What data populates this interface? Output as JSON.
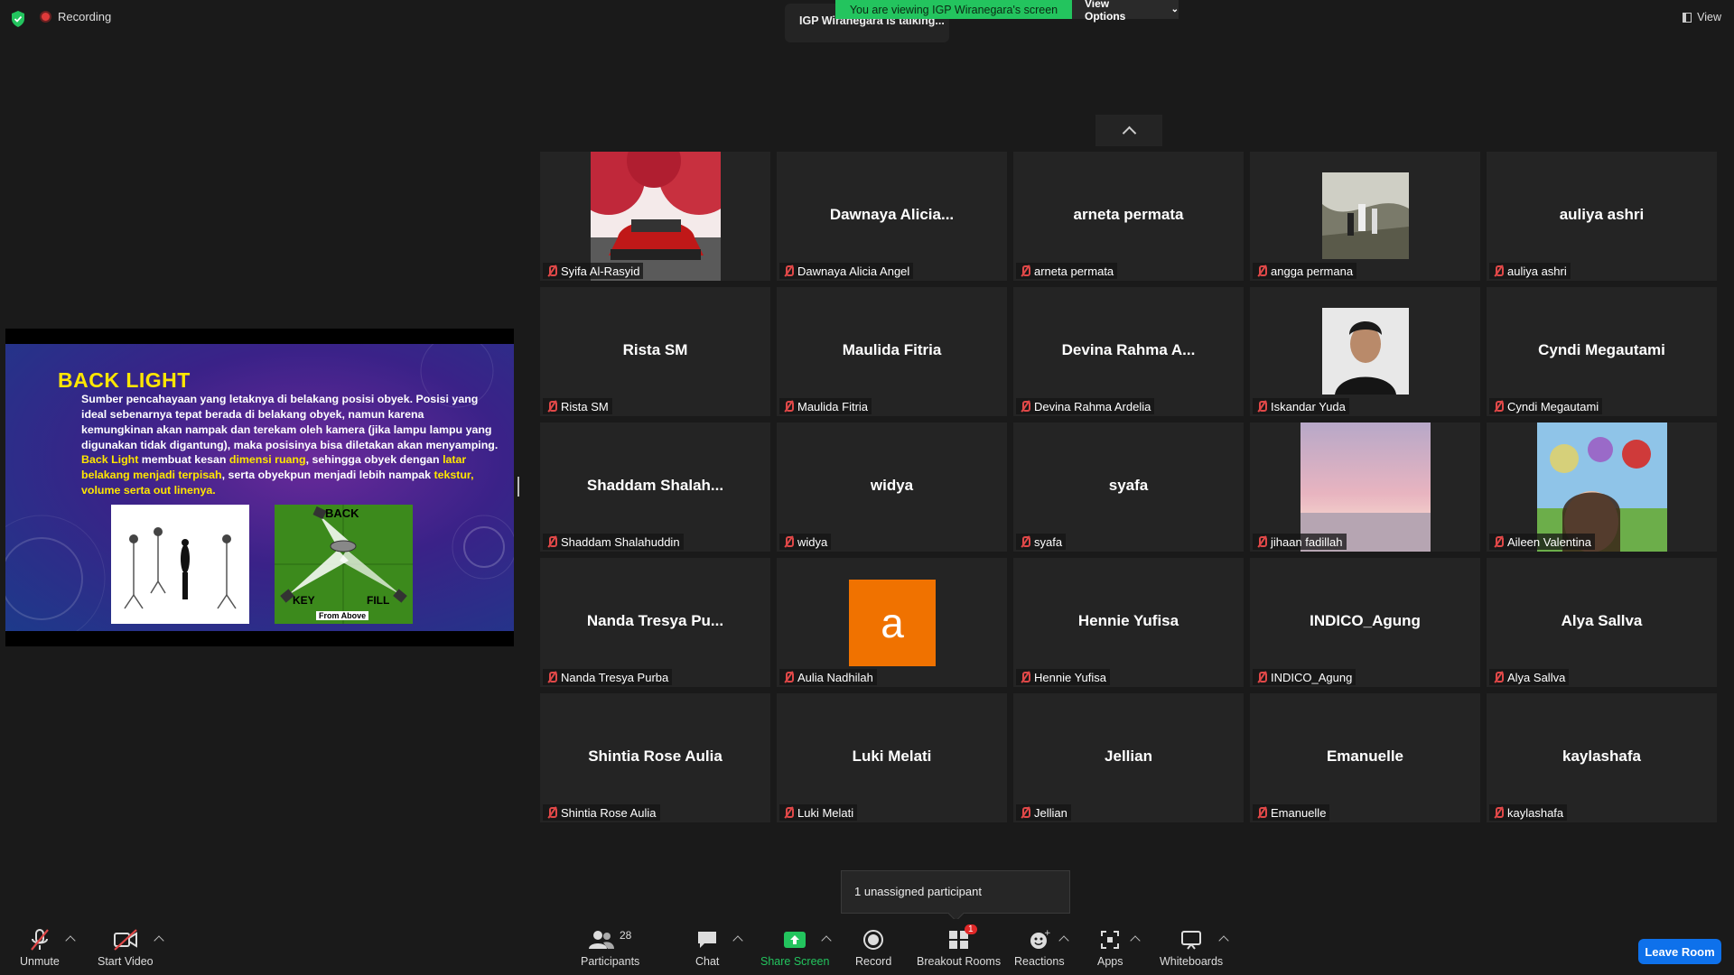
{
  "top": {
    "recording": "Recording",
    "viewing_banner": "You are viewing IGP Wiranegara's screen",
    "view_options": "View Options",
    "talking": "IGP Wiranegara is talking...",
    "view": "View"
  },
  "slide": {
    "title": "BACK LIGHT",
    "para1": "Sumber pencahayaan yang letaknya di belakang posisi obyek. Posisi yang ideal sebenarnya tepat berada di belakang obyek, namun karena kemungkinan akan nampak dan terekam oleh kamera (jika lampu lampu yang digunakan tidak digantung), maka posisinya bisa diletakan akan menyamping.",
    "p2_a": "Back Light",
    "p2_b": " membuat kesan ",
    "p2_c": "dimensi ruang",
    "p2_d": ", sehingga obyek dengan ",
    "p2_e": "latar belakang menjadi terpisah",
    "p2_f": ", serta obyekpun menjadi lebih nampak ",
    "p2_g": "tekstur, volume serta out linenya.",
    "diagram_back": "BACK",
    "diagram_key": "KEY",
    "diagram_fill": "FILL",
    "diagram_caption": "From Above"
  },
  "tiles": [
    {
      "name": "Syifa Al-Rasyid",
      "big": "",
      "video": "car"
    },
    {
      "name": "Dawnaya Alicia Angel",
      "big": "Dawnaya  Alicia..."
    },
    {
      "name": "arneta permata",
      "big": "arneta permata"
    },
    {
      "name": "angga permana",
      "big": "",
      "video": "outdoor"
    },
    {
      "name": "auliya ashri",
      "big": "auliya ashri"
    },
    {
      "name": "Rista SM",
      "big": "Rista SM"
    },
    {
      "name": "Maulida Fitria",
      "big": "Maulida Fitria"
    },
    {
      "name": "Devina Rahma Ardelia",
      "big": "Devina  Rahma  A..."
    },
    {
      "name": "Iskandar Yuda",
      "big": "",
      "video": "person"
    },
    {
      "name": "Cyndi Megautami",
      "big": "Cyndi Megautami"
    },
    {
      "name": "Shaddam Shalahuddin",
      "big": "Shaddam  Shalah..."
    },
    {
      "name": "widya",
      "big": "widya"
    },
    {
      "name": "syafa",
      "big": "syafa"
    },
    {
      "name": "jihaan fadillah",
      "big": "",
      "video": "sky"
    },
    {
      "name": "Aileen Valentina",
      "big": "",
      "video": "selfie"
    },
    {
      "name": "Nanda Tresya Purba",
      "big": "Nanda  Tresya  Pu..."
    },
    {
      "name": "Aulia Nadhilah",
      "big": "",
      "avatar": "a"
    },
    {
      "name": "Hennie Yufisa",
      "big": "Hennie Yufisa"
    },
    {
      "name": "INDICO_Agung",
      "big": "INDICO_Agung"
    },
    {
      "name": "Alya Sallva",
      "big": "Alya Sallva"
    },
    {
      "name": "Shintia Rose Aulia",
      "big": "Shintia Rose Aulia"
    },
    {
      "name": "Luki Melati",
      "big": "Luki Melati"
    },
    {
      "name": "Jellian",
      "big": "Jellian"
    },
    {
      "name": "Emanuelle",
      "big": "Emanuelle"
    },
    {
      "name": "kaylashafa",
      "big": "kaylashafa"
    }
  ],
  "popup": "1 unassigned participant",
  "toolbar": {
    "unmute": "Unmute",
    "start_video": "Start Video",
    "participants": "Participants",
    "participants_count": "28",
    "chat": "Chat",
    "share_screen": "Share Screen",
    "record": "Record",
    "breakout": "Breakout Rooms",
    "breakout_badge": "1",
    "reactions": "Reactions",
    "apps": "Apps",
    "whiteboards": "Whiteboards",
    "leave": "Leave Room"
  },
  "colors": {
    "accent_green": "#23c45e",
    "leave_blue": "#0e71eb",
    "mute_red": "#e04848"
  }
}
